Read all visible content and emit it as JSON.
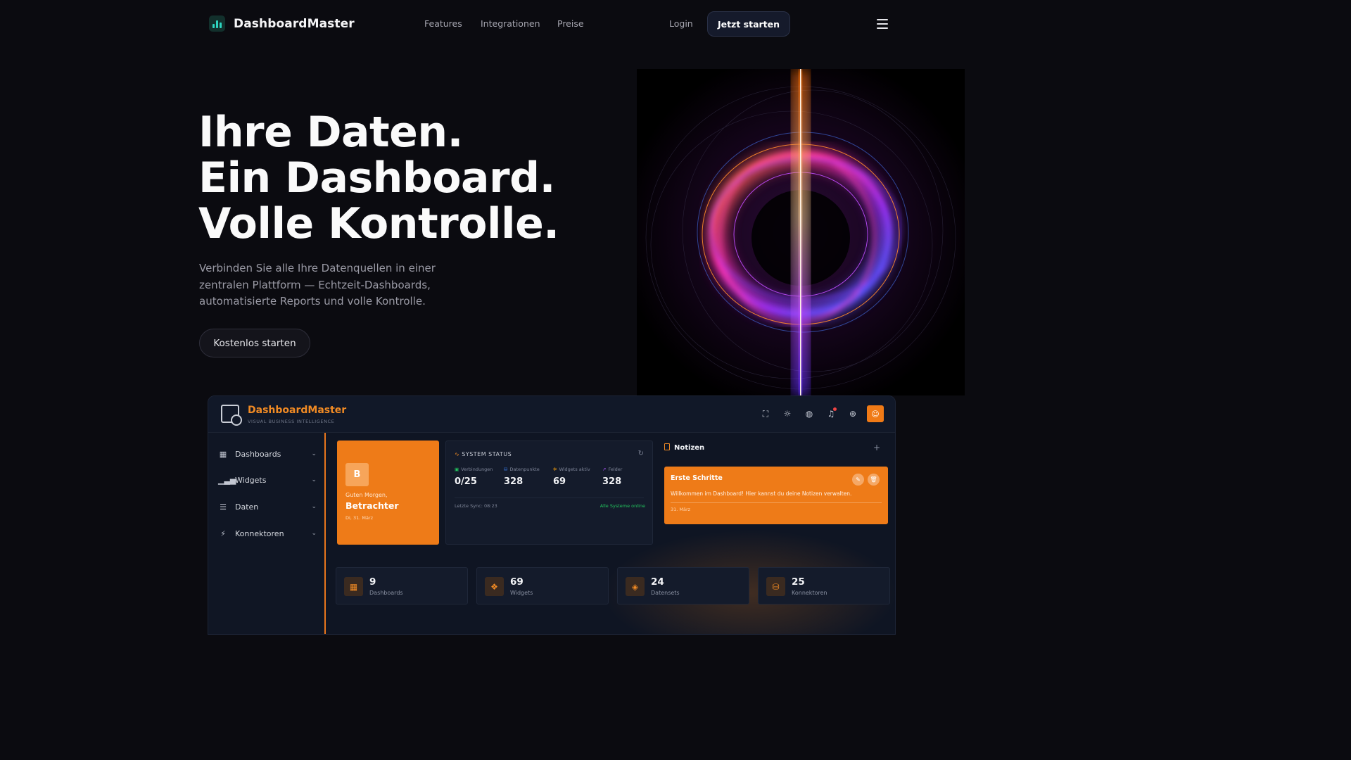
{
  "nav": {
    "brand": "DashboardMaster",
    "links": [
      "Features",
      "Integrationen",
      "Preise"
    ],
    "login": "Login",
    "cta": "Jetzt starten"
  },
  "hero": {
    "title_lines": [
      "Ihre Daten.",
      "Ein Dashboard.",
      "Volle Kontrolle."
    ],
    "subtitle": "Verbinden Sie alle Ihre Datenquellen in einer zentralen Plattform — Echtzeit-Dashboards, automatisierte Reports und volle Kontrolle.",
    "cta": "Kostenlos starten"
  },
  "dashboard": {
    "title": "DashboardMaster",
    "tagline": "VISUAL BUSINESS INTELLIGENCE",
    "header_icons": [
      "fullscreen-icon",
      "sun-icon",
      "palette-icon",
      "bell-icon",
      "globe-icon",
      "user-icon"
    ],
    "sidebar": [
      {
        "label": "Dashboards",
        "icon": "grid-icon"
      },
      {
        "label": "Widgets",
        "icon": "bar-chart-icon"
      },
      {
        "label": "Daten",
        "icon": "database-icon"
      },
      {
        "label": "Konnektoren",
        "icon": "plug-icon"
      }
    ],
    "greeting": {
      "avatar": "B",
      "hello": "Guten Morgen,",
      "name": "Betrachter",
      "date": "Di, 31. März"
    },
    "status": {
      "title": "SYSTEM STATUS",
      "items": [
        {
          "label": "Verbindungen",
          "value": "0/25",
          "color": "#22c55e"
        },
        {
          "label": "Datenpunkte",
          "value": "328",
          "color": "#3b82f6"
        },
        {
          "label": "Widgets aktiv",
          "value": "69",
          "color": "#f59e0b"
        },
        {
          "label": "Felder",
          "value": "328",
          "color": "#a855f7"
        }
      ],
      "sync": "Letzte Sync: 08:23",
      "ok": "Alle Systeme online"
    },
    "notes": {
      "title": "Notizen",
      "note_title": "Erste Schritte",
      "note_text": "Willkommen im Dashboard! Hier kannst du deine Notizen verwalten.",
      "note_date": "31. März"
    },
    "kpis": [
      {
        "value": "9",
        "label": "Dashboards",
        "icon": "grid-icon"
      },
      {
        "value": "69",
        "label": "Widgets",
        "icon": "widgets-icon"
      },
      {
        "value": "24",
        "label": "Datensets",
        "icon": "layers-icon"
      },
      {
        "value": "25",
        "label": "Konnektoren",
        "icon": "database-icon"
      }
    ],
    "accent": "#f07a16"
  }
}
